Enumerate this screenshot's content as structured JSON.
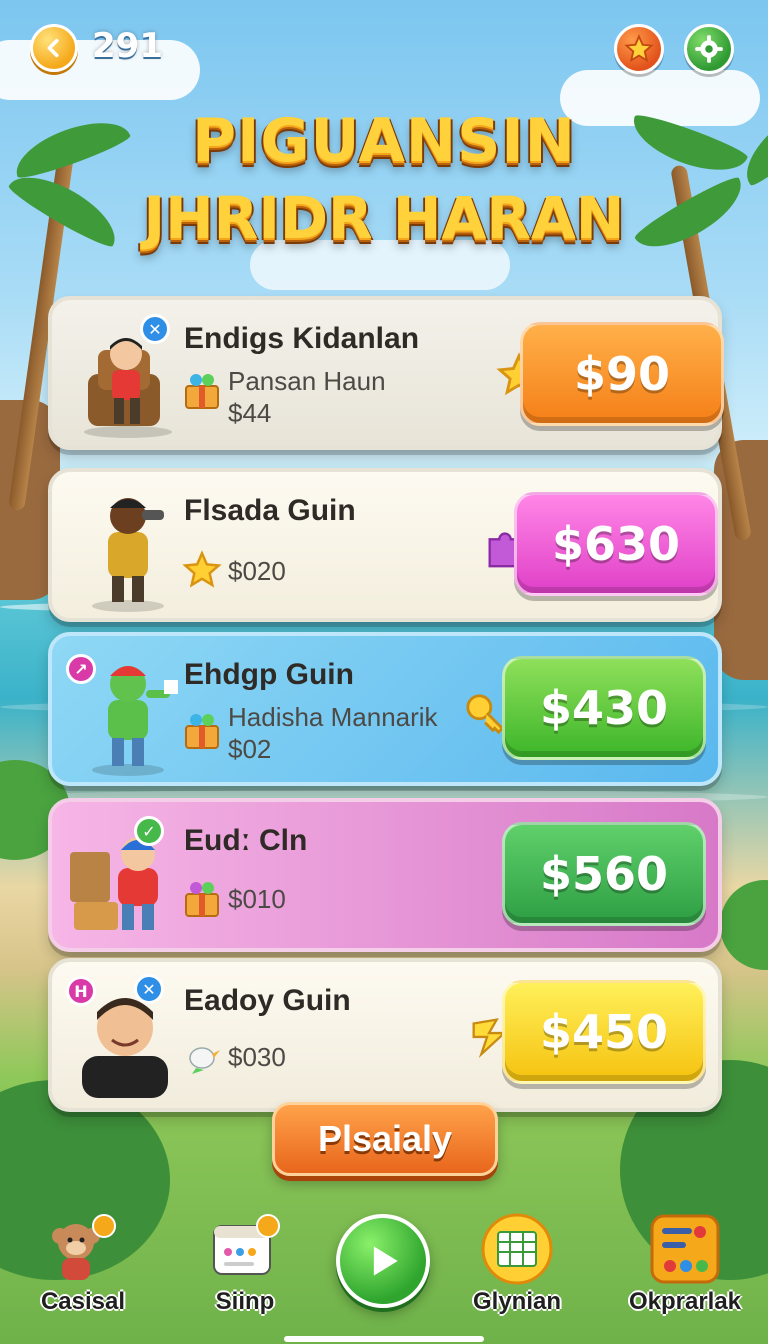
{
  "topbar": {
    "coins": "291",
    "back_icon": "chevron-left-icon",
    "star_icon": "star-icon",
    "settings_icon": "gear-icon"
  },
  "title": {
    "line1": "PIGUANSIN",
    "line2": "JHRIDR HARAN"
  },
  "cards": [
    {
      "name": "Endigs Kidanlan",
      "sub1": "Pansan Haun",
      "sub2": "$44",
      "price": "$90",
      "badge": "close-icon",
      "button_color": "#f57f17"
    },
    {
      "name": "Flsada Guin",
      "sub1": "$020",
      "price": "$630",
      "button_color": "#e040c8"
    },
    {
      "name": "Ehdgp Guin",
      "sub1": "Hadisha Mannarik",
      "sub2": "$02",
      "price": "$430",
      "button_color": "#3cb52a"
    },
    {
      "name": "Eudː Cln",
      "sub1": "$010",
      "price": "$560",
      "button_color": "#2e9e44"
    },
    {
      "name": "Eadoy Guin",
      "sub1": "$030",
      "price": "$450",
      "button_color": "#f5c20f"
    }
  ],
  "main_button": {
    "label": "Plsaialy"
  },
  "nav": [
    {
      "label": "Casisal",
      "icon": "monkey-icon"
    },
    {
      "label": "Siinp",
      "icon": "calendar-icon"
    },
    {
      "label": "",
      "icon": "play-icon"
    },
    {
      "label": "Glynian",
      "icon": "spreadsheet-icon"
    },
    {
      "label": "Okprarlak",
      "icon": "controller-icon"
    }
  ]
}
